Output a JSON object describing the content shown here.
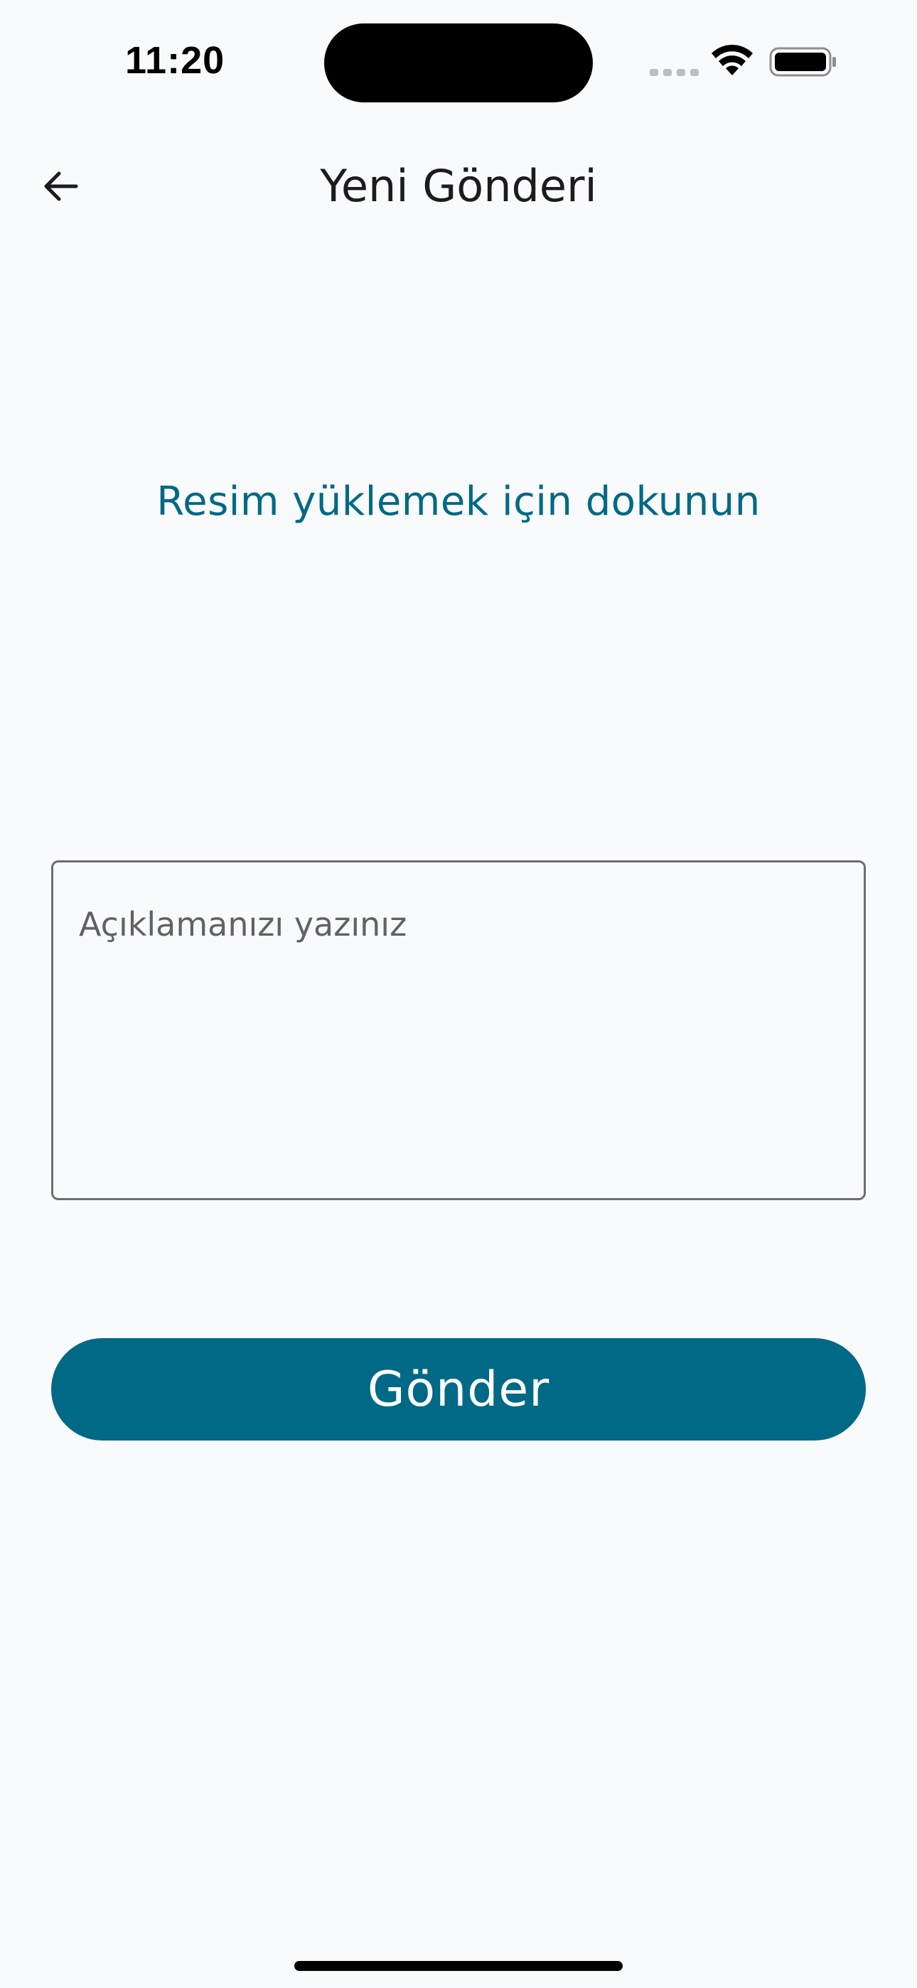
{
  "status_bar": {
    "time": "11:20",
    "signal_icon": "cellular-signal-icon",
    "wifi_icon": "wifi-icon",
    "battery_icon": "battery-icon"
  },
  "app_bar": {
    "back_icon": "arrow-left-icon",
    "title": "Yeni Gönderi"
  },
  "upload": {
    "prompt": "Resim yüklemek için dokunun"
  },
  "description": {
    "placeholder": "Açıklamanızı yazınız",
    "value": ""
  },
  "submit": {
    "label": "Gönder"
  },
  "colors": {
    "accent": "#006985",
    "background": "#F9FAFC",
    "border": "#6E6E72",
    "placeholder": "#626266"
  }
}
